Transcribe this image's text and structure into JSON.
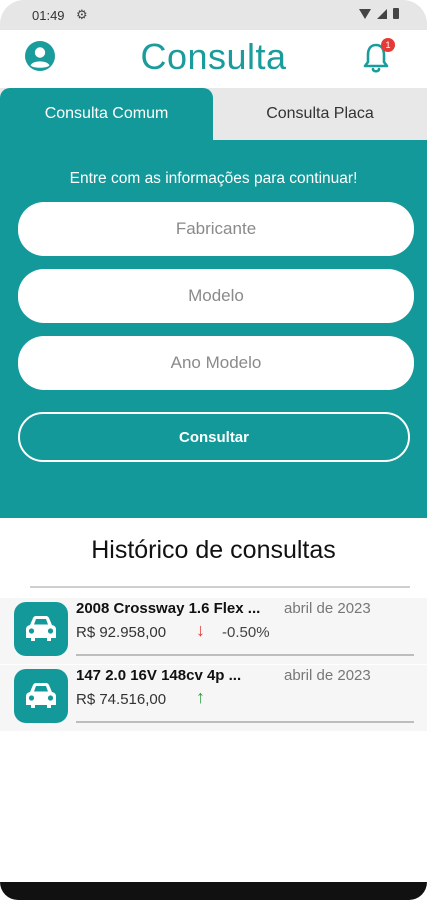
{
  "status_bar": {
    "time": "01:49",
    "icons": [
      "settings-gear",
      "wifi",
      "signal",
      "battery"
    ]
  },
  "header": {
    "title": "Consulta",
    "notification_count": "1",
    "accent_color": "#1a9c9c"
  },
  "tabs": [
    {
      "label": "Consulta Comum",
      "active": true
    },
    {
      "label": "Consulta Placa",
      "active": false
    }
  ],
  "form": {
    "instruction": "Entre com as informações para continuar!",
    "manufacturer_placeholder": "Fabricante",
    "model_placeholder": "Modelo",
    "year_placeholder": "Ano Modelo",
    "submit_label": "Consultar",
    "panel_color": "#13999a"
  },
  "history": {
    "title": "Histórico de consultas",
    "items": [
      {
        "name": "2008 Crossway 1.6 Flex ...",
        "date": "abril de 2023",
        "price": "R$ 92.958,00",
        "trend": "down",
        "variation": "-0.50%"
      },
      {
        "name": "147 2.0 16V 148cv 4p ...",
        "date": "abril de 2023",
        "price": "R$ 74.516,00",
        "trend": "up",
        "variation": ""
      }
    ]
  },
  "colors": {
    "trend_down": "#e53935",
    "trend_up": "#2e9e3e"
  }
}
